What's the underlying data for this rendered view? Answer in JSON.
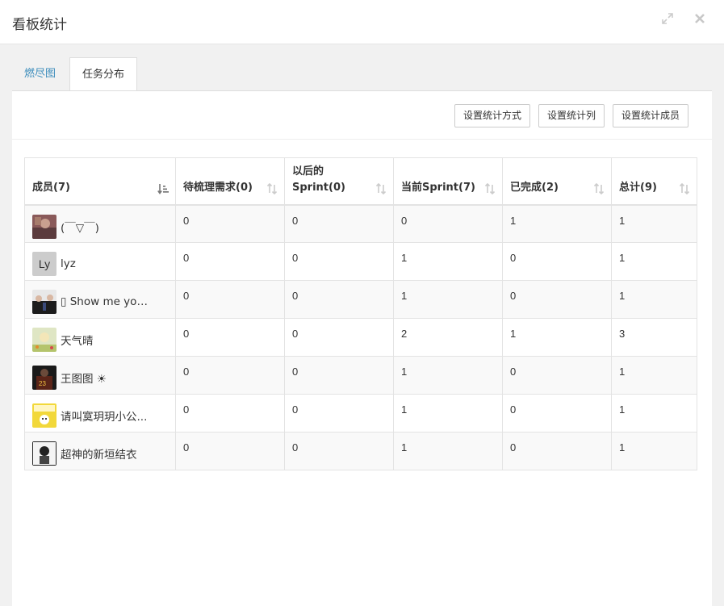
{
  "dialog": {
    "title": "看板统计",
    "expand_icon": "expand-icon",
    "close_icon": "close-icon"
  },
  "tabs": [
    {
      "label": "燃尽图",
      "active": false
    },
    {
      "label": "任务分布",
      "active": true
    }
  ],
  "toolbar": {
    "btn_method": "设置统计方式",
    "btn_columns": "设置统计列",
    "btn_members": "设置统计成员"
  },
  "table": {
    "headers": [
      {
        "label": "成员(7)",
        "icon": "sort-amount-down-icon"
      },
      {
        "label": "待梳理需求(0)",
        "icon": "sort-icon"
      },
      {
        "label_line1": "以后的",
        "label_line2": "Sprint(0)",
        "icon": "sort-icon"
      },
      {
        "label": "当前Sprint(7)",
        "icon": "sort-icon"
      },
      {
        "label": "已完成(2)",
        "icon": "sort-icon"
      },
      {
        "label": "总计(9)",
        "icon": "sort-icon"
      }
    ],
    "rows": [
      {
        "name": "(￣▽￣)",
        "avatar": "avatar-photo",
        "avatar_color": "#8a5a5a",
        "values": [
          "0",
          "0",
          "0",
          "1",
          "1"
        ]
      },
      {
        "name": "lyz",
        "avatar": "avatar-text",
        "avatar_text": "Ly",
        "values": [
          "0",
          "0",
          "1",
          "0",
          "1"
        ]
      },
      {
        "name": "▯ Show me your...",
        "avatar": "avatar-photo",
        "avatar_color": "#222222",
        "values": [
          "0",
          "0",
          "1",
          "0",
          "1"
        ]
      },
      {
        "name": "天气晴",
        "avatar": "avatar-photo",
        "avatar_color": "#c7d59b",
        "values": [
          "0",
          "0",
          "2",
          "1",
          "3"
        ]
      },
      {
        "name": "王图图 ☀",
        "avatar": "avatar-photo",
        "avatar_color": "#3a1f1a",
        "values": [
          "0",
          "0",
          "1",
          "0",
          "1"
        ]
      },
      {
        "name": "请叫寞玥玥小公...",
        "avatar": "avatar-photo",
        "avatar_color": "#f2d83a",
        "values": [
          "0",
          "0",
          "1",
          "0",
          "1"
        ]
      },
      {
        "name": "超神的新垣结衣",
        "avatar": "avatar-photo",
        "avatar_color": "#555555",
        "values": [
          "0",
          "0",
          "1",
          "0",
          "1"
        ]
      }
    ]
  },
  "colors": {
    "link": "#3c8dbc",
    "border": "#e3e3e3",
    "stripe": "#f9f9f9",
    "background": "#f1f1f1"
  }
}
